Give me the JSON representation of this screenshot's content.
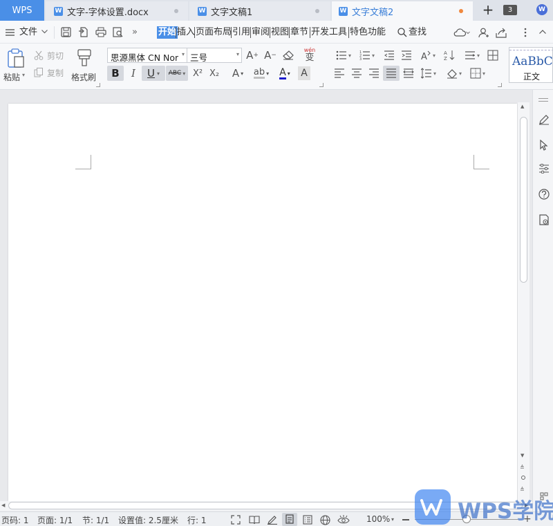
{
  "tabs": {
    "wps_label": "WPS",
    "items": [
      {
        "label": "文字-字体设置.docx"
      },
      {
        "label": "文字文稿1"
      },
      {
        "label": "文字文稿2"
      }
    ],
    "add_label": "+",
    "window_count": "3",
    "badge_letter": "W"
  },
  "menu": {
    "file_label": "文件",
    "items": [
      "开始",
      "插入",
      "页面布局",
      "引用",
      "审阅",
      "视图",
      "章节",
      "开发工具",
      "特色功能"
    ],
    "active_index": 0,
    "search_label": "查找",
    "more_label": "»"
  },
  "ribbon": {
    "paste_label": "粘贴",
    "cut_label": "剪切",
    "copy_label": "复制",
    "format_painter_label": "格式刷",
    "font_name": "思源黑体 CN Nor",
    "font_size": "三号",
    "bold": "B",
    "italic": "I",
    "underline": "U",
    "strike": "ABC",
    "sup": "X²",
    "sub": "X₂",
    "style_preview": "AaBbC",
    "style_name": "正文",
    "wen_label": "wén",
    "wen_char": "变"
  },
  "status": {
    "page_code": "页码: 1",
    "pages": "页面: 1/1",
    "section": "节: 1/1",
    "setting": "设置值: 2.5厘米",
    "line": "行: 1",
    "zoom": "100%"
  },
  "watermark": {
    "text": "WPS学院"
  },
  "colors": {
    "accent": "#4a8fe7",
    "active_menu_bg": "#4a8fe7",
    "tab_active_text": "#3b7fd8",
    "font_color_bar": "#1a1acc"
  }
}
